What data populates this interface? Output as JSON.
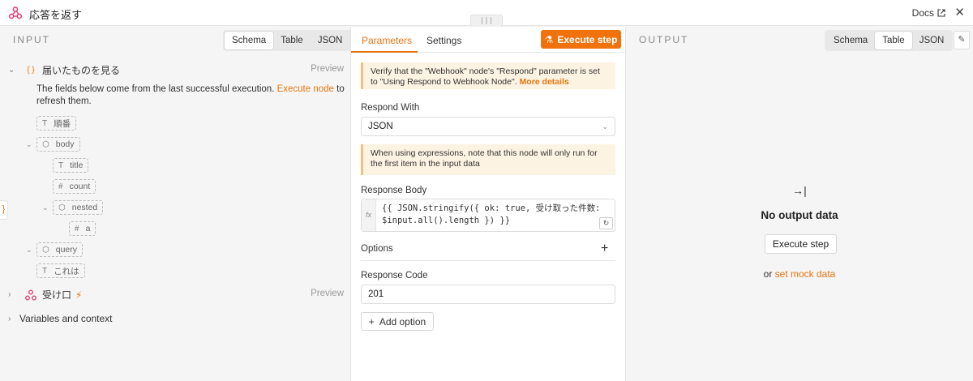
{
  "header": {
    "title": "応答を返す",
    "docs_label": "Docs",
    "close_label": "✕",
    "handle": "|||"
  },
  "input_panel": {
    "label": "INPUT",
    "view_tabs": [
      "Schema",
      "Table",
      "JSON"
    ],
    "active_tab": "Schema",
    "node1": {
      "name": "届いたものを見る",
      "icon": "{ }",
      "preview": "Preview"
    },
    "help_text_1": "The fields below come from the last successful execution. ",
    "help_link": "Execute node",
    "help_text_2": " to refresh them.",
    "schema": [
      {
        "icon": "T",
        "name": "順番"
      },
      {
        "icon": "cube",
        "name": "body"
      },
      {
        "icon": "T",
        "name": "title"
      },
      {
        "icon": "#",
        "name": "count"
      },
      {
        "icon": "cube",
        "name": "nested"
      },
      {
        "icon": "#",
        "name": "a"
      },
      {
        "icon": "cube",
        "name": "query"
      },
      {
        "icon": "T",
        "name": "これは"
      }
    ],
    "node2": {
      "name": "受け口",
      "preview": "Preview"
    },
    "variables_label": "Variables and context",
    "left_accent": "}"
  },
  "param_panel": {
    "tabs": [
      "Parameters",
      "Settings"
    ],
    "active_tab": "Parameters",
    "execute_label": "Execute step",
    "notice1_text": "Verify that the \"Webhook\" node's \"Respond\" parameter is set to \"Using Respond to Webhook Node\". ",
    "notice1_link": "More details",
    "respond_with_label": "Respond With",
    "respond_with_value": "JSON",
    "notice2_text": "When using expressions, note that this node will only run for the first item in the input data",
    "response_body_label": "Response Body",
    "fx_label": "fx",
    "response_body_value": "{{ JSON.stringify({ ok: true, 受け取った件数: $input.all().length }) }}",
    "options_label": "Options",
    "plus_label": "+",
    "response_code_label": "Response Code",
    "response_code_value": "201",
    "add_option_label": "Add option"
  },
  "output_panel": {
    "label": "OUTPUT",
    "view_tabs": [
      "Schema",
      "Table",
      "JSON"
    ],
    "active_tab": "Table",
    "empty_icon": "→|",
    "empty_title": "No output data",
    "execute_label": "Execute step",
    "mock_prefix": "or ",
    "mock_link": "set mock data"
  },
  "colors": {
    "accent": "#f0720c",
    "notice_bg": "#fdf3e2"
  }
}
